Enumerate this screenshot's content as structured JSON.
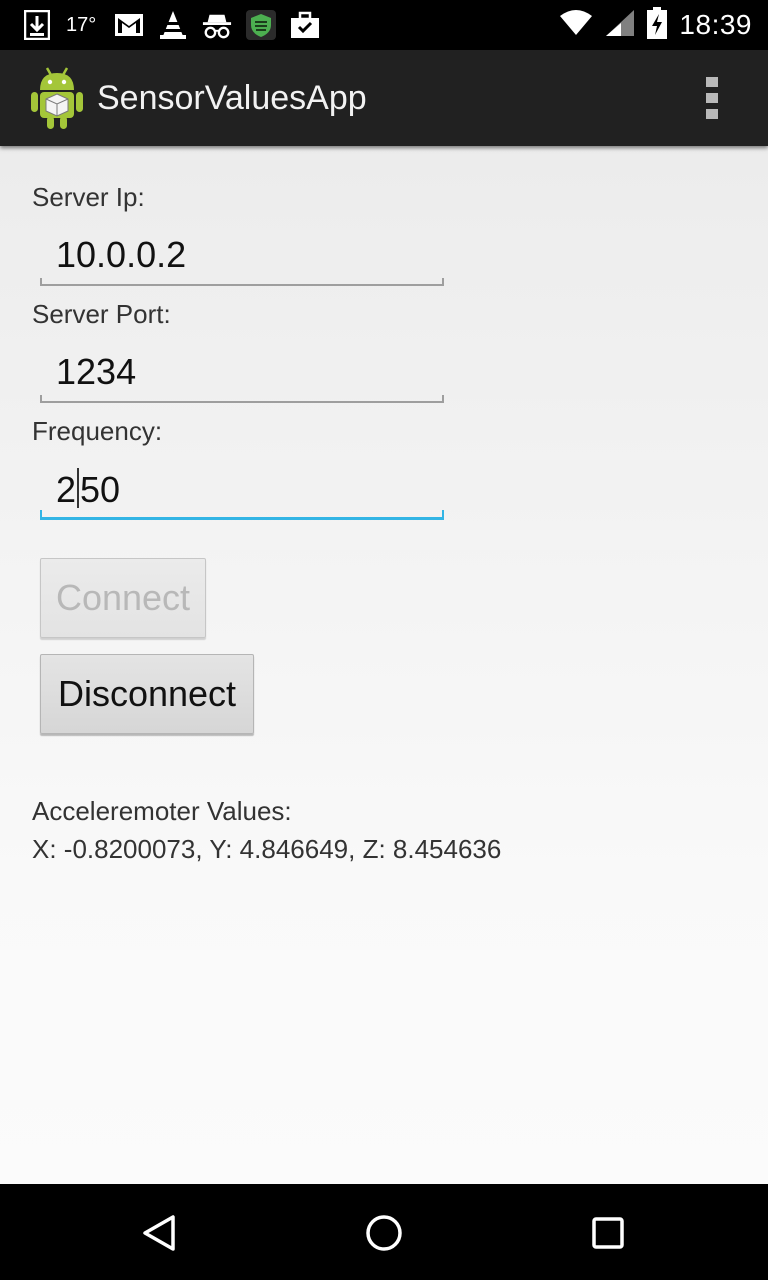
{
  "status_bar": {
    "temperature": "17°",
    "time": "18:39",
    "left_icons": [
      "download-icon",
      "temperature-text",
      "gmail-icon",
      "vlc-cone-icon",
      "incognito-icon",
      "shield-icon",
      "briefcase-check-icon"
    ],
    "right_icons": [
      "wifi-icon",
      "signal-icon",
      "battery-charging-icon"
    ]
  },
  "action_bar": {
    "title": "SensorValuesApp",
    "icon": "android-robot-icon",
    "overflow_icon": "overflow-menu-icon"
  },
  "form": {
    "server_ip_label": "Server Ip:",
    "server_ip_value": "10.0.0.2",
    "server_port_label": "Server Port:",
    "server_port_value": "1234",
    "frequency_label": "Frequency:",
    "frequency_value_before_cursor": "2",
    "frequency_value_after_cursor": "50"
  },
  "buttons": {
    "connect_label": "Connect",
    "connect_enabled": false,
    "disconnect_label": "Disconnect"
  },
  "accelerometer": {
    "title": "Acceleremoter Values:",
    "values_text": "X: -0.8200073, Y: 4.846649, Z: 8.454636"
  },
  "colors": {
    "focus_accent": "#33b5e5",
    "actionbar_bg": "#212121",
    "android_green": "#a4c639"
  }
}
